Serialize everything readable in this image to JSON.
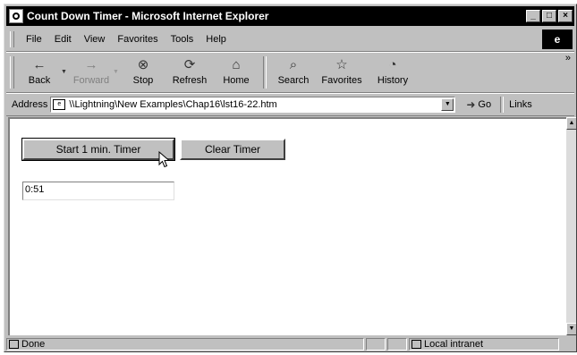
{
  "window": {
    "title": "Count Down Timer - Microsoft Internet Explorer",
    "buttons": [
      "_",
      "□",
      "×"
    ]
  },
  "menu": {
    "items": [
      {
        "label": "File",
        "key": "F"
      },
      {
        "label": "Edit",
        "key": "E"
      },
      {
        "label": "View",
        "key": "V"
      },
      {
        "label": "Favorites",
        "key": "a"
      },
      {
        "label": "Tools",
        "key": "T"
      },
      {
        "label": "Help",
        "key": "H"
      }
    ]
  },
  "toolbar": {
    "back": "Back",
    "forward": "Forward",
    "stop": "Stop",
    "refresh": "Refresh",
    "home": "Home",
    "search": "Search",
    "favorites": "Favorites",
    "history": "History",
    "icons": {
      "back": "←",
      "forward": "→",
      "stop": "⊗",
      "refresh": "⟳",
      "home": "⌂",
      "search": "⌕",
      "favorites": "☆",
      "history": "◔"
    }
  },
  "addressbar": {
    "label": "Address",
    "url": "\\\\Lightning\\New Examples\\Chap16\\lst16-22.htm",
    "go": "Go",
    "links": "Links"
  },
  "page": {
    "start_button": "Start 1 min. Timer",
    "clear_button": "Clear Timer",
    "timer_value": "0:51"
  },
  "status": {
    "text": "Done",
    "zone": "Local intranet"
  }
}
